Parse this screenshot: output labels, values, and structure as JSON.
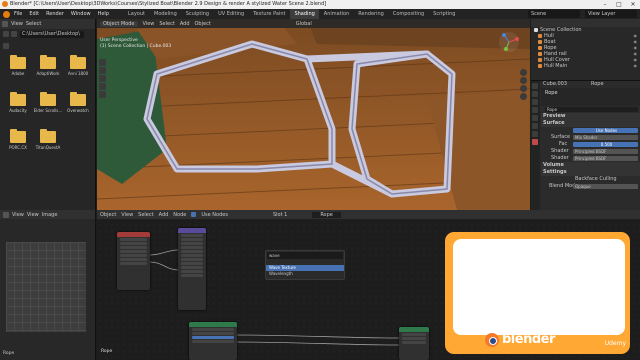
{
  "title": "Blender* [C:\\Users\\User\\Desktop\\3DWorks\\Courses\\Stylized Boat\\Blender 2.9 Design & render A stylized Water Scene 2.blend]",
  "menu": [
    "File",
    "Edit",
    "Render",
    "Window",
    "Help"
  ],
  "workspaces": [
    "Layout",
    "Modeling",
    "Sculpting",
    "UV Editing",
    "Texture Paint",
    "Shading",
    "Animation",
    "Rendering",
    "Compositing",
    "Scripting"
  ],
  "active_workspace": "Shading",
  "scene": "Scene",
  "view_layer": "View Layer",
  "filebrowser": {
    "menu": [
      "View",
      "Select"
    ],
    "path": "C:\\Users\\User\\Desktop\\",
    "folders": [
      "Adobe",
      "AdaptiWork",
      "Anni 1800",
      "Audacity",
      "Elder Scrolls...",
      "Overwatch",
      "PORC.CX",
      "TitanQuestA"
    ]
  },
  "viewport": {
    "mode": "Object Mode",
    "menu": [
      "View",
      "Select",
      "Add",
      "Object"
    ],
    "info_line1": "User Perspective",
    "info_line2": "(1) Scene Collection | Cube.003",
    "shading_label": "Global"
  },
  "outliner": {
    "rows": [
      {
        "name": "Scene Collection"
      },
      {
        "name": "Hull"
      },
      {
        "name": "Boat"
      },
      {
        "name": "Rope"
      },
      {
        "name": "Hand rail"
      },
      {
        "name": "Hull Cover"
      },
      {
        "name": "Hull Main"
      }
    ]
  },
  "properties": {
    "object": "Cube.003",
    "material_tab": "Rope",
    "material_name": "Rope",
    "preview": "Preview",
    "surface": "Surface",
    "use_nodes": "Use Nodes",
    "surface_label": "Surface",
    "surface_value": "Mix Shader",
    "fac_label": "Fac",
    "fac_value": "0.500",
    "shader1_label": "Shader",
    "shader1_value": "Principled BSDF",
    "shader2_label": "Shader",
    "shader2_value": "Principled BSDF",
    "volume": "Volume",
    "settings": "Settings",
    "backface": "Backface Culling",
    "blend_mode_label": "Blend Mode",
    "blend_mode_value": "Opaque"
  },
  "image_editor": {
    "menu": [
      "View",
      "View",
      "Image"
    ],
    "label": "Rope"
  },
  "node_editor": {
    "type": "Object",
    "menu": [
      "View",
      "Select",
      "Add",
      "Node"
    ],
    "use_nodes": "Use Nodes",
    "slot": "Slot 1",
    "material": "Rope",
    "search_query": "wave",
    "results": [
      "Wave Texture",
      "Wavelength"
    ],
    "frame_label": "Rope"
  },
  "overlay": {
    "brand": "blender",
    "udemy": "Udemy"
  },
  "colors": {
    "accent": "#4772b3",
    "blender_orange": "#e87d0d",
    "overlay_orange": "#ffa834"
  }
}
